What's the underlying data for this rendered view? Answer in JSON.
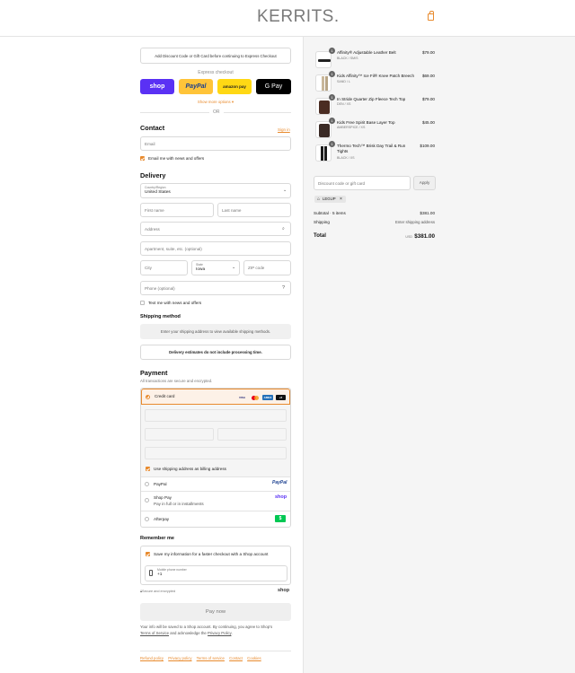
{
  "header": {
    "logo": "KERRITS.",
    "cart_icon": "shopping-bag-icon",
    "accent": "#e88a2d"
  },
  "notice": "Add Discount Code or Gift Card before continuing to Express Checkout",
  "express": {
    "label": "Express checkout",
    "buttons": {
      "shop": "shop",
      "paypal": "PayPal",
      "amazon": "amazon pay",
      "gpay": "G Pay"
    },
    "show_more": "Show more options ▾",
    "or": "OR"
  },
  "contact": {
    "title": "Contact",
    "sign_in": "Sign in",
    "email_placeholder": "Email",
    "news_label": "Email me with news and offers"
  },
  "delivery": {
    "title": "Delivery",
    "country_label": "Country/Region",
    "country_value": "United States",
    "first_name": "First name",
    "last_name": "Last name",
    "address": "Address",
    "apartment": "Apartment, suite, etc. (optional)",
    "city": "City",
    "state_label": "State",
    "state_value": "Iowa",
    "zip": "ZIP code",
    "phone": "Phone (optional)",
    "text_label": "Text me with news and offers"
  },
  "shipping": {
    "title": "Shipping method",
    "message": "Enter your shipping address to view available shipping methods.",
    "notice": "Delivery estimates do not include processing time."
  },
  "payment": {
    "title": "Payment",
    "subtitle": "All transactions are secure and encrypted.",
    "credit_card": "Credit card",
    "card_logos": [
      "VISA",
      "MC",
      "AMEX",
      "+6"
    ],
    "billing_label": "Use shipping address as billing address",
    "paypal": "PayPal",
    "shop_pay": "Shop Pay",
    "shop_pay_sub": "Pay in full or in installments",
    "shop_logo": "shop",
    "afterpay": "Afterpay"
  },
  "remember": {
    "title": "Remember me",
    "save_label": "Save my information for a faster checkout with a Shop account",
    "mobile_label": "Mobile phone number",
    "mobile_value": "+1",
    "secure": "Secure and encrypted",
    "shop_logo": "shop"
  },
  "pay_now": "Pay now",
  "terms": {
    "line1": "Your info will be saved to a Shop account. By continuing, you agree to Shop's",
    "terms_link": "Terms of Service",
    "mid": "and acknowledge the",
    "privacy_link": "Privacy Policy",
    "end": "."
  },
  "footer": [
    "Refund policy",
    "Privacy policy",
    "Terms of service",
    "Contact",
    "Cookies"
  ],
  "cart": {
    "items": [
      {
        "qty": "1",
        "name": "Affinity® Adjustable Leather Belt",
        "variant": "BLACK / SM/S",
        "price": "$79.00"
      },
      {
        "qty": "1",
        "name": "Kids Affinity™ Ice Fil® Knee Patch Breech",
        "variant": "SAND / L",
        "price": "$69.00"
      },
      {
        "qty": "1",
        "name": "In Stride Quarter Zip Fleece Tech Top",
        "variant": "DEN / XS",
        "price": "$79.00"
      },
      {
        "qty": "1",
        "name": "Kids Free Spirit Base Layer Top",
        "variant": "AMBERSPICE / XS",
        "price": "$45.00"
      },
      {
        "qty": "1",
        "name": "Thermo Tech™ Brisk Day Trail & Run Tights",
        "variant": "BLACK / XS",
        "price": "$109.00"
      }
    ],
    "discount_placeholder": "Discount code or gift card",
    "apply": "Apply",
    "tag": "LEGUP",
    "subtotal_label": "Subtotal · 5 items",
    "subtotal_value": "$381.00",
    "shipping_label": "Shipping",
    "shipping_value": "Enter shipping address",
    "total_label": "Total",
    "currency": "USD",
    "total_value": "$381.00"
  }
}
